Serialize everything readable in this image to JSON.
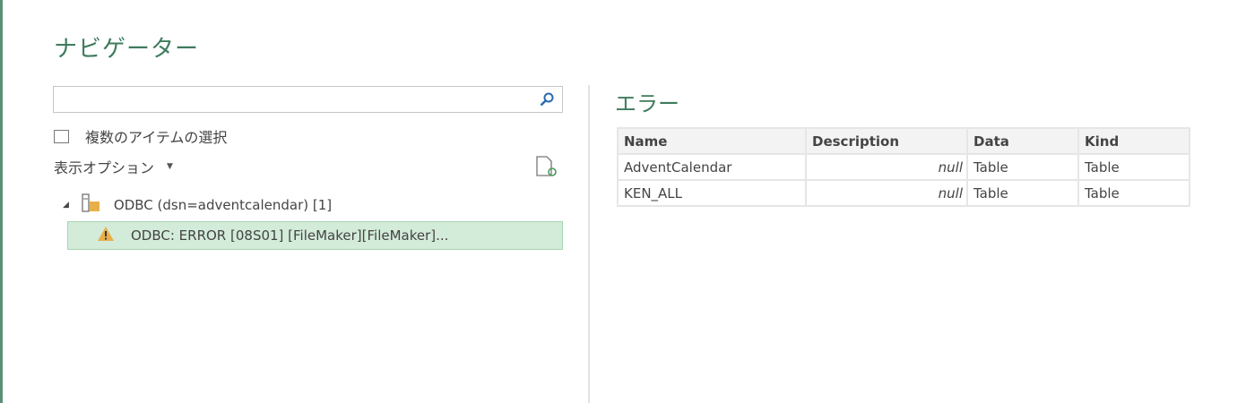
{
  "navigator": {
    "title": "ナビゲーター",
    "search": {
      "value": "",
      "placeholder": ""
    },
    "multi_select_label": "複数のアイテムの選択",
    "display_options_label": "表示オプション",
    "tree": {
      "root_label": "ODBC (dsn=adventcalendar) [1]",
      "error_item_label": "ODBC: ERROR [08S01] [FileMaker][FileMaker]..."
    }
  },
  "preview": {
    "title": "エラー",
    "columns": [
      "Name",
      "Description",
      "Data",
      "Kind"
    ],
    "rows": [
      [
        "AdventCalendar",
        "null",
        "Table",
        "Table"
      ],
      [
        "KEN_ALL",
        "null",
        "Table",
        "Table"
      ]
    ]
  },
  "colors": {
    "accent": "#3f7b5c",
    "selected_bg": "#d3ebd9",
    "warning": "#e8b04a"
  }
}
